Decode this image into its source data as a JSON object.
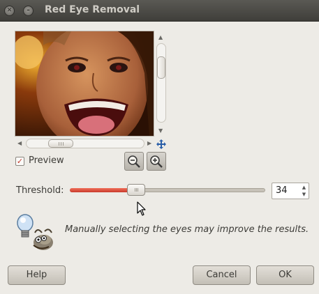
{
  "window": {
    "title": "Red Eye Removal"
  },
  "preview": {
    "label": "Preview",
    "checked": true
  },
  "threshold": {
    "label": "Threshold:",
    "value": "34",
    "level": 0.34
  },
  "hint": {
    "text": "Manually selecting the eyes may improve the results."
  },
  "buttons": {
    "help": "Help",
    "cancel": "Cancel",
    "ok": "OK"
  },
  "icons": {
    "close": "close-icon",
    "minimize": "minimize-icon",
    "zoom_out": "zoom-out-icon",
    "zoom_in": "zoom-in-icon",
    "navigate": "navigate-icon",
    "hint": "gimp-lightbulb-icon"
  },
  "colors": {
    "titlebar": "#4c4b47",
    "slider_fill": "#d9493a",
    "background": "#edebe6"
  }
}
